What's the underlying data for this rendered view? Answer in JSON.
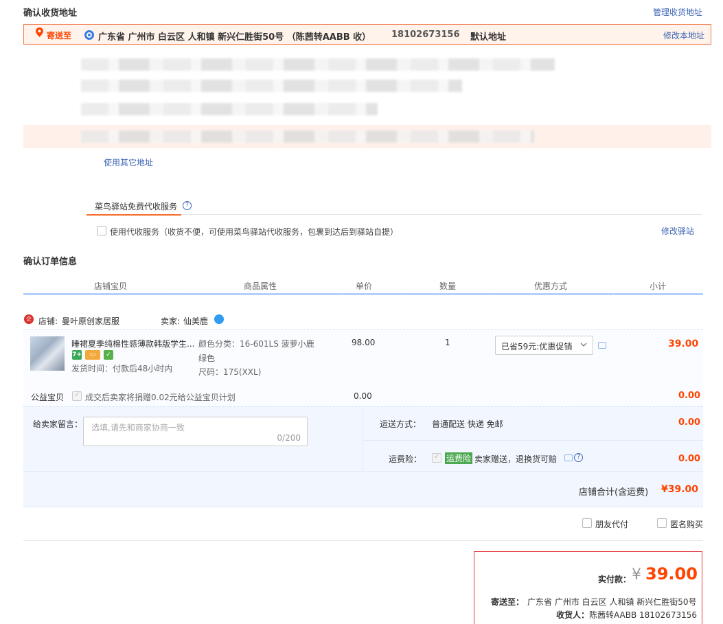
{
  "address_section": {
    "title": "确认收货地址",
    "manage_link": "管理收货地址",
    "ship_to_label": "寄送至",
    "selected_address": "广东省 广州市 白云区 人和镇 新兴仁胜街50号 （陈茜转AABB 收）",
    "selected_phone": "18102673156",
    "default_tag": "默认地址",
    "edit_link": "修改本地址",
    "use_other_link": "使用其它地址"
  },
  "cainiao": {
    "tab_label": "菜鸟驿站免费代收服务",
    "help_icon": "question-circle-icon",
    "checkbox_label": "使用代收服务（收货不便，可使用菜鸟驿站代收服务，包裹到达后到驿站自提）",
    "edit_link": "修改驿站"
  },
  "order_section": {
    "title": "确认订单信息",
    "columns": [
      "店铺宝贝",
      "商品属性",
      "单价",
      "数量",
      "优惠方式",
      "小计"
    ],
    "shop": {
      "label": "店铺:",
      "name": "曼叶原创家居服",
      "seller_label": "卖家:",
      "seller_name": "仙美鹿"
    },
    "item": {
      "title": "睡裙夏季纯棉性感薄款韩版学生...",
      "delivery": "发货时间：付款后48小时内",
      "attr_color": "颜色分类：16-601LS 菠萝小鹿",
      "attr_color_cont": "绿色",
      "attr_size": "尺码：175(XXL)",
      "unit_price": "98.00",
      "quantity": "1",
      "promo": "已省59元:优惠促销",
      "subtotal": "39.00"
    },
    "charity": {
      "label": "公益宝贝",
      "text": "成交后卖家将捐赠0.02元给公益宝贝计划",
      "price": "0.00",
      "subtotal": "0.00"
    },
    "message": {
      "label": "给卖家留言：",
      "placeholder": "选填,请先和商家协商一致",
      "counter": "0/200"
    },
    "shipping": {
      "label": "运送方式：",
      "value": "普通配送 快递 免邮",
      "price": "0.00"
    },
    "insurance": {
      "label": "运费险：",
      "tag": "运费险",
      "text": "卖家赠送，退换货可赔",
      "price": "0.00"
    },
    "shop_total_label": "店铺合计(含运费)",
    "shop_total": "¥39.00",
    "friend_pay": "朋友代付",
    "anonymous": "匿名购买"
  },
  "payment": {
    "label": "实付款：",
    "currency": "¥",
    "amount": "39.00",
    "ship_label": "寄送至：",
    "ship_value": "广东省 广州市 白云区 人和镇 新兴仁胜街50号",
    "receiver_label": "收货人：",
    "receiver_value": "陈茜转AABB 18102673156"
  },
  "colors": {
    "accent": "#ff4400",
    "link": "#3c64b4",
    "table_header_border": "#b2d1ff"
  }
}
